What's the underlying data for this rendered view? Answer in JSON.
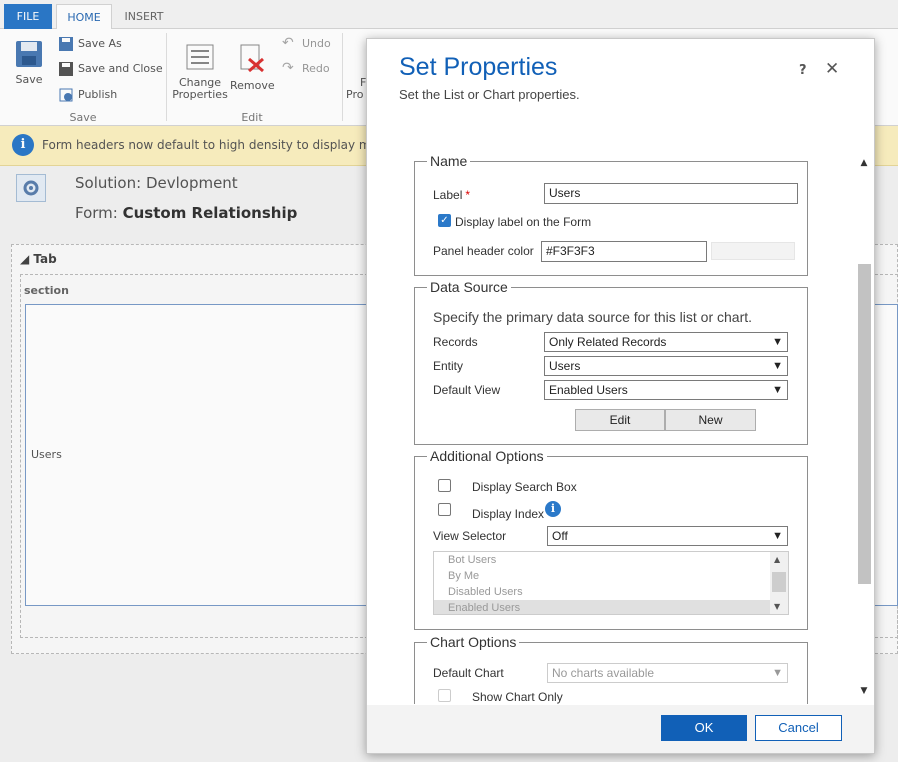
{
  "tabs": {
    "file": "FILE",
    "home": "HOME",
    "insert": "INSERT"
  },
  "ribbon": {
    "save": "Save",
    "save_as": "Save As",
    "save_and_close": "Save and Close",
    "publish": "Publish",
    "save_group": "Save",
    "change_properties_1": "Change",
    "change_properties_2": "Properties",
    "remove": "Remove",
    "undo": "Undo",
    "redo": "Redo",
    "edit_group": "Edit",
    "form_properties_partial_1": "F",
    "form_properties_partial_2": "Pro"
  },
  "notification": {
    "text": "Form headers now default to high density to display more dat"
  },
  "form_header": {
    "solution_label": "Solution: ",
    "solution_name": "Devlopment",
    "form_label": "Form: ",
    "form_name": "Custom Relationship"
  },
  "canvas": {
    "tab_title": "Tab",
    "section_title": "section",
    "subgrid_label": "Users"
  },
  "dialog": {
    "title": "Set Properties",
    "subtitle": "Set the List or Chart properties.",
    "help": "?",
    "close": "✕",
    "ok": "OK",
    "cancel": "Cancel",
    "name_section": {
      "legend": "Name",
      "label_label": "Label",
      "required_mark": "*",
      "label_value": "Users",
      "display_label_text": "Display label on the Form",
      "display_label_checked": true,
      "panel_header_color_label": "Panel header color",
      "panel_header_color_value": "#F3F3F3"
    },
    "data_source": {
      "legend": "Data Source",
      "description": "Specify the primary data source for this list or chart.",
      "records_label": "Records",
      "records_value": "Only Related Records",
      "entity_label": "Entity",
      "entity_value": "Users",
      "default_view_label": "Default View",
      "default_view_value": "Enabled Users",
      "edit_button": "Edit",
      "new_button": "New"
    },
    "additional_options": {
      "legend": "Additional Options",
      "display_search_box": "Display Search Box",
      "display_index": "Display Index",
      "view_selector_label": "View Selector",
      "view_selector_value": "Off",
      "views": [
        "Bot Users",
        "By Me",
        "Disabled Users",
        "Enabled Users"
      ]
    },
    "chart_options": {
      "legend": "Chart Options",
      "default_chart_label": "Default Chart",
      "default_chart_value": "No charts available",
      "show_chart_only": "Show Chart Only"
    }
  },
  "colors": {
    "accent": "#1160b7",
    "notify_bg": "#fbf0c0",
    "file_tab": "#2b79c9"
  }
}
